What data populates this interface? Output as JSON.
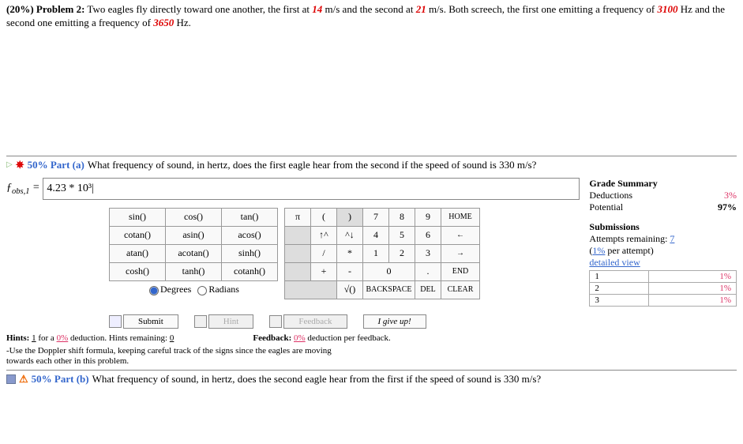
{
  "problem": {
    "weight": "(20%) Problem 2:",
    "text_1": " Two eagles fly directly toward one another, the first at ",
    "v1": "14",
    "text_2": " m/s and the second at ",
    "v2": "21",
    "text_3": " m/s. Both screech, the first one emitting a frequency of ",
    "f1": "3100",
    "text_4": " Hz and the second one emitting a frequency of ",
    "f2": "3650",
    "text_5": " Hz."
  },
  "part_a": {
    "marker_pct": "50% Part (a)",
    "question": "  What frequency of sound, in hertz, does the first eagle hear from the second if the speed of sound is 330 m/s?",
    "var_html": "ƒ<sub>obs,1</sub> = ",
    "answer": "4.23 * 10³|"
  },
  "grade": {
    "title": "Grade Summary",
    "deduct_lbl": "Deductions",
    "deduct_val": "3%",
    "pot_lbl": "Potential",
    "pot_val": "97%"
  },
  "submissions": {
    "title": "Submissions",
    "remaining_lbl": "Attempts remaining: ",
    "remaining_val": "7",
    "per_attempt": "(1% per attempt)",
    "detailed": "detailed view",
    "rows": [
      {
        "n": "1",
        "p": "1%"
      },
      {
        "n": "2",
        "p": "1%"
      },
      {
        "n": "3",
        "p": "1%"
      }
    ]
  },
  "keypad": {
    "fns": [
      [
        "sin()",
        "cos()",
        "tan()"
      ],
      [
        "cotan()",
        "asin()",
        "acos()"
      ],
      [
        "atan()",
        "acotan()",
        "sinh()"
      ],
      [
        "cosh()",
        "tanh()",
        "cotanh()"
      ]
    ],
    "nums": [
      [
        "π",
        "(",
        ")",
        "7",
        "8",
        "9",
        "HOME"
      ],
      [
        "",
        "↑^",
        "^↓",
        "4",
        "5",
        "6",
        "←"
      ],
      [
        "",
        "/",
        "*",
        "1",
        "2",
        "3",
        "→"
      ],
      [
        "",
        "+",
        "-",
        "0",
        "",
        ".",
        "END"
      ],
      [
        "",
        "",
        "√()",
        "BACKSPACE",
        "",
        "DEL",
        "CLEAR"
      ]
    ],
    "deg": "Degrees",
    "rad": "Radians"
  },
  "buttons": {
    "submit": "Submit",
    "hint": "Hint",
    "feedback": "Feedback",
    "giveup": "I give up!"
  },
  "hints": {
    "line_lbl": "Hints: ",
    "hint_count": "1",
    "line_mid": " for a ",
    "hint_pct": "0%",
    "line_end": " deduction. Hints remaining: ",
    "hint_rem": "0",
    "fb_lbl": "Feedback: ",
    "fb_pct": "0%",
    "fb_end": " deduction per feedback.",
    "hint_text": "-Use the Doppler shift formula, keeping careful track of the signs since the eagles are moving towards each other in this problem."
  },
  "part_b": {
    "marker_pct": "50% Part (b)",
    "question": "  What frequency of sound, in hertz, does the second eagle hear from the first if the speed of sound is 330 m/s?"
  }
}
